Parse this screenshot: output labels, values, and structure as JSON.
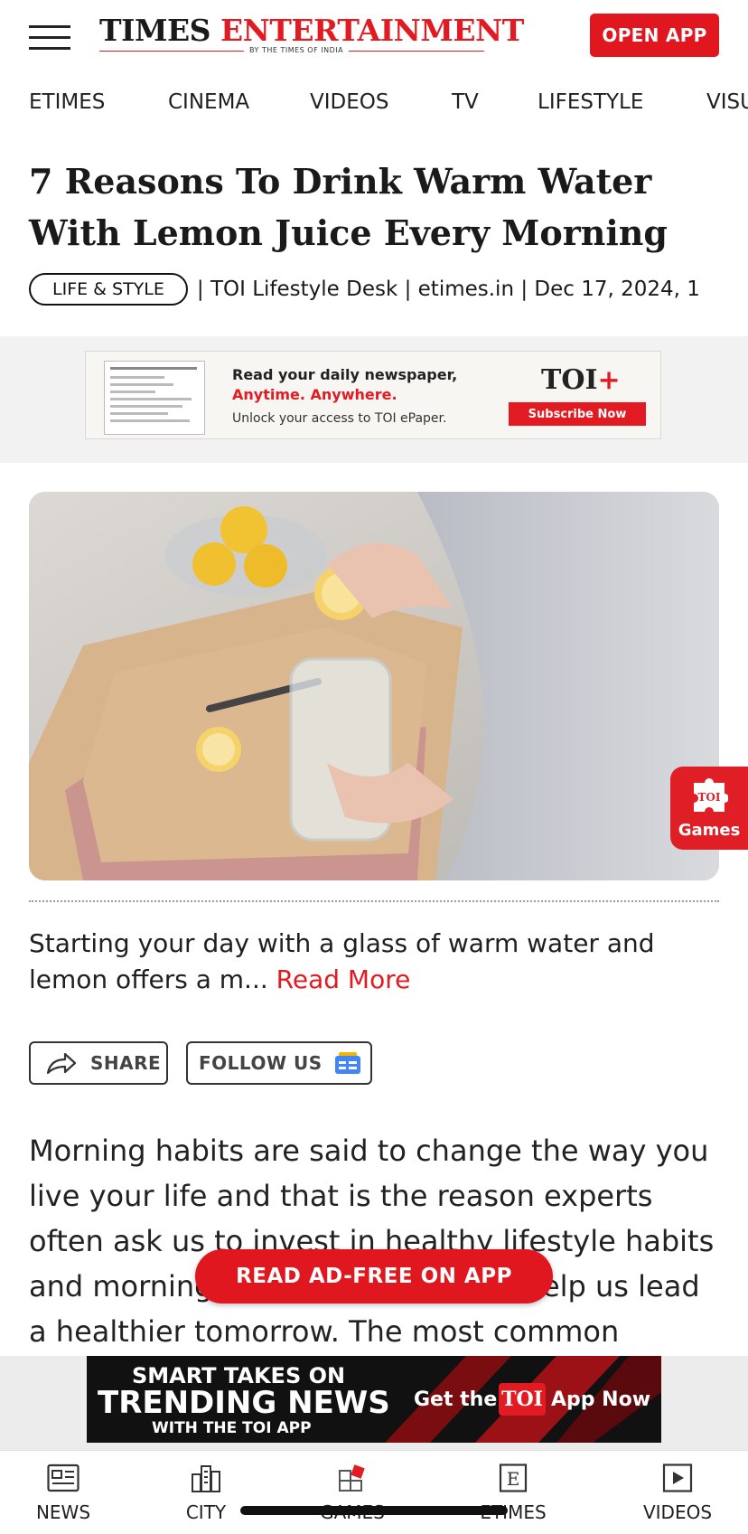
{
  "header": {
    "brand_part1": "TIMES",
    "brand_part2": "ENTERTAINMENT",
    "brand_tagline": "BY THE TIMES OF INDIA",
    "open_app_label": "OPEN APP"
  },
  "nav": {
    "items": [
      {
        "label": "ETIMES"
      },
      {
        "label": "CINEMA"
      },
      {
        "label": "VIDEOS"
      },
      {
        "label": "TV"
      },
      {
        "label": "LIFESTYLE"
      },
      {
        "label": "VISU"
      }
    ]
  },
  "article": {
    "title": "7 Reasons To Drink Warm Water With Lemon Juice Every Morning",
    "category": "LIFE & STYLE",
    "byline": "| TOI Lifestyle Desk | etimes.in | Dec 17, 2024, 1",
    "summary": "Starting your day with a glass of warm water and lemon offers a m...",
    "read_more": "Read More",
    "body": "Morning habits are said to change the way you live your life and that is the reason experts often ask us to invest in healthy lifestyle habits and morning routines, which may help us lead a healthier tomorrow. The most common"
  },
  "top_ad": {
    "line1": "Read your daily newspaper,",
    "line2": "Anytime. Anywhere.",
    "line3": "Unlock your access to TOI ePaper.",
    "brand": "TOI",
    "brand_plus": "+",
    "cta": "Subscribe Now"
  },
  "games_widget": {
    "badge": "TOI",
    "label": "Games"
  },
  "actions": {
    "share_label": "SHARE",
    "follow_label": "FOLLOW US"
  },
  "read_ad_free_label": "READ AD-FREE ON APP",
  "bottom_ad": {
    "line1": "SMART TAKES ON",
    "line2": "TRENDING NEWS",
    "line3": "WITH THE TOI APP",
    "get": "Get the",
    "badge": "TOI",
    "app": "App Now"
  },
  "bottom_nav": {
    "tabs": [
      {
        "label": "NEWS",
        "icon": "newspaper-icon"
      },
      {
        "label": "CITY",
        "icon": "city-buildings-icon"
      },
      {
        "label": "GAMES",
        "icon": "games-puzzle-icon"
      },
      {
        "label": "ETIMES",
        "icon": "etimes-e-icon"
      },
      {
        "label": "VIDEOS",
        "icon": "play-icon"
      }
    ]
  },
  "colors": {
    "accent": "#e21b22",
    "text": "#1a1a1a"
  }
}
